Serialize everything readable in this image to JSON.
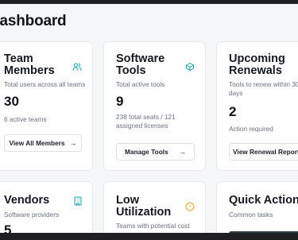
{
  "page": {
    "title": "Dashboard"
  },
  "cards": {
    "team": {
      "title": "Team\nMembers",
      "desc": "Total users across all teams",
      "value": "30",
      "sub": "6 active teams",
      "button": "View All Members",
      "icon": "users-icon"
    },
    "software": {
      "title": "Software\nTools",
      "desc": "Total active tools",
      "value": "9",
      "sub": "238 total seats / 121\nassigned licenses",
      "button": "Manage Tools",
      "icon": "box-icon"
    },
    "renewals": {
      "title": "Upcoming\nRenewals",
      "desc": "Tools to renew within 30\ndays",
      "value": "2",
      "sub": "Action required",
      "button": "View Renewal Report"
    },
    "vendors": {
      "title": "Vendors",
      "desc": "Software providers",
      "value": "5",
      "icon": "building-icon"
    },
    "utilization": {
      "title": "Low\nUtilization",
      "desc": "Teams with potential cost",
      "icon": "alert-circle-icon"
    },
    "quick": {
      "title": "Quick Actions",
      "desc": "Common tasks"
    }
  },
  "colors": {
    "accent_icon": "#1aa3a3",
    "warning_icon": "#e0a526",
    "brand_dark": "#111318"
  }
}
